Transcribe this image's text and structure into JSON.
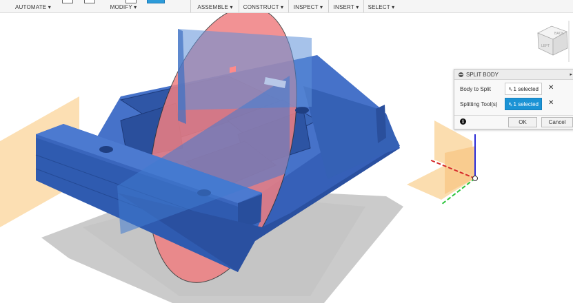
{
  "toolbar": {
    "groups": [
      {
        "label": "AUTOMATE ▾"
      },
      {
        "label": "MODIFY ▾"
      },
      {
        "label": "ASSEMBLE ▾"
      },
      {
        "label": "CONSTRUCT ▾"
      },
      {
        "label": "INSPECT ▾"
      },
      {
        "label": "INSERT ▾"
      },
      {
        "label": "SELECT ▾"
      }
    ]
  },
  "viewcube": {
    "faces": [
      "LEFT",
      "BACK"
    ]
  },
  "split_body_panel": {
    "title": "SPLIT BODY",
    "collapse_icon": "minus-circle-icon",
    "expand_icon": "triangle-right-icon",
    "rows": [
      {
        "label": "Body to Split",
        "value": "1 selected",
        "active": false
      },
      {
        "label": "Splitting Tool(s)",
        "value": "1 selected",
        "active": true
      }
    ],
    "info_icon": "i",
    "ok_label": "OK",
    "cancel_label": "Cancel"
  },
  "colors": {
    "body_blue": "#3660b8",
    "split_plane_red": "#f07f82",
    "construction_plane_blue": "#4b8fd6",
    "plane_yellow": "#fbd9a6",
    "active_selection": "#1b93d5"
  }
}
